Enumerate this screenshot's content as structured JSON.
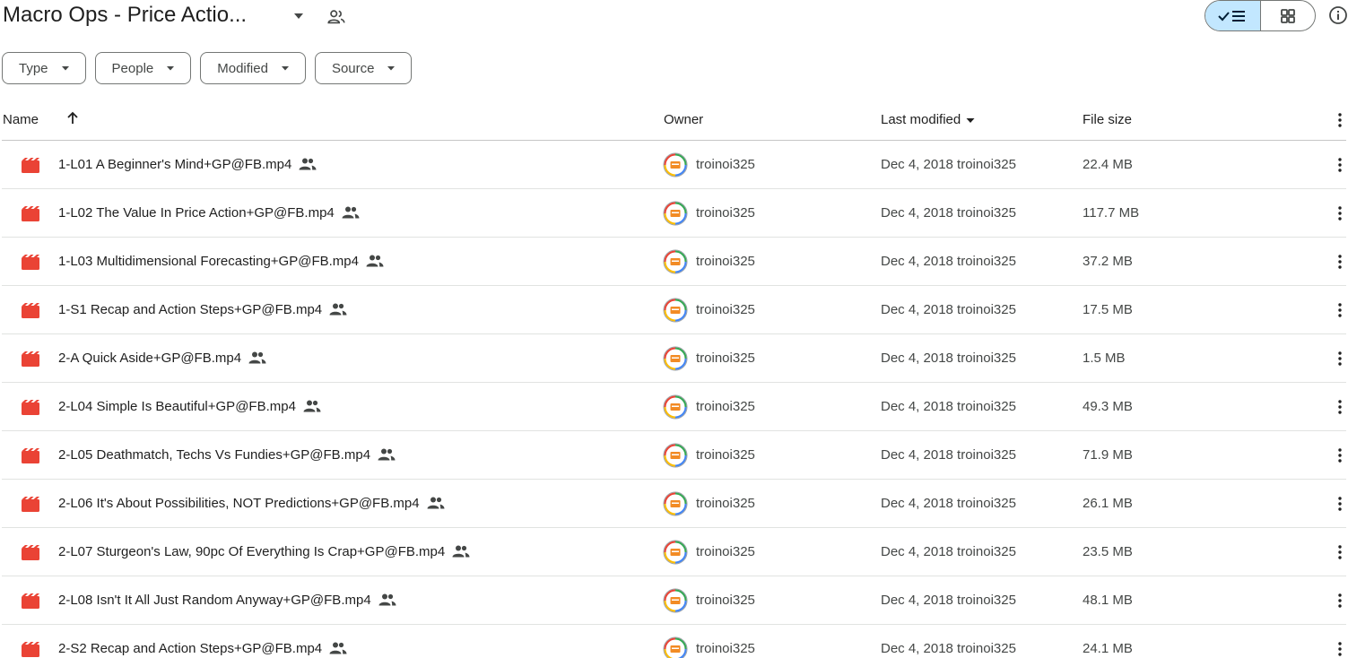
{
  "header": {
    "title": "Macro Ops - Price Actio..."
  },
  "filters": [
    {
      "label": "Type"
    },
    {
      "label": "People"
    },
    {
      "label": "Modified"
    },
    {
      "label": "Source"
    }
  ],
  "columns": {
    "name": "Name",
    "owner": "Owner",
    "modified": "Last modified",
    "size": "File size"
  },
  "colors": {
    "file_icon": "#ea4335",
    "toggle_active": "#c2e7ff"
  },
  "files": [
    {
      "name": "1-L01 A Beginner's Mind+GP@FB.mp4",
      "owner": "troinoi325",
      "modified": "Dec 4, 2018 troinoi325",
      "size": "22.4 MB"
    },
    {
      "name": "1-L02 The Value In Price Action+GP@FB.mp4",
      "owner": "troinoi325",
      "modified": "Dec 4, 2018 troinoi325",
      "size": "117.7 MB"
    },
    {
      "name": "1-L03 Multidimensional Forecasting+GP@FB.mp4",
      "owner": "troinoi325",
      "modified": "Dec 4, 2018 troinoi325",
      "size": "37.2 MB"
    },
    {
      "name": "1-S1 Recap and Action Steps+GP@FB.mp4",
      "owner": "troinoi325",
      "modified": "Dec 4, 2018 troinoi325",
      "size": "17.5 MB"
    },
    {
      "name": "2-A Quick Aside+GP@FB.mp4",
      "owner": "troinoi325",
      "modified": "Dec 4, 2018 troinoi325",
      "size": "1.5 MB"
    },
    {
      "name": "2-L04 Simple Is Beautiful+GP@FB.mp4",
      "owner": "troinoi325",
      "modified": "Dec 4, 2018 troinoi325",
      "size": "49.3 MB"
    },
    {
      "name": "2-L05 Deathmatch, Techs Vs Fundies+GP@FB.mp4",
      "owner": "troinoi325",
      "modified": "Dec 4, 2018 troinoi325",
      "size": "71.9 MB"
    },
    {
      "name": "2-L06 It's About Possibilities, NOT Predictions+GP@FB.mp4",
      "owner": "troinoi325",
      "modified": "Dec 4, 2018 troinoi325",
      "size": "26.1 MB"
    },
    {
      "name": "2-L07 Sturgeon's Law, 90pc Of Everything Is Crap+GP@FB.mp4",
      "owner": "troinoi325",
      "modified": "Dec 4, 2018 troinoi325",
      "size": "23.5 MB"
    },
    {
      "name": "2-L08 Isn't It All Just Random Anyway+GP@FB.mp4",
      "owner": "troinoi325",
      "modified": "Dec 4, 2018 troinoi325",
      "size": "48.1 MB"
    },
    {
      "name": "2-S2 Recap and Action Steps+GP@FB.mp4",
      "owner": "troinoi325",
      "modified": "Dec 4, 2018 troinoi325",
      "size": "24.1 MB"
    }
  ]
}
